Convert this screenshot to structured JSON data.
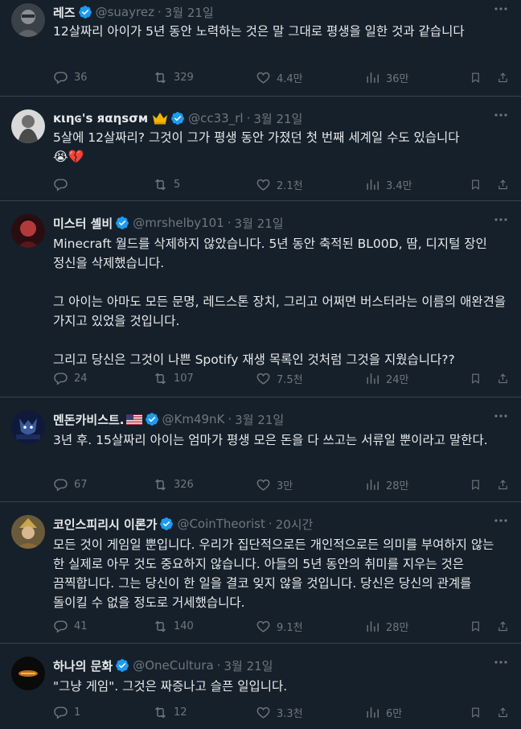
{
  "tweets": [
    {
      "name": "레즈",
      "handle": "@suayrez",
      "time": "3월 21일",
      "text": [
        "12살짜리 아이가 5년 동안 노력하는 것은 말 그대로 평생을 일한 것과 같습니다"
      ],
      "replies": "36",
      "retweets": "329",
      "likes": "4.4만",
      "views": "36만"
    },
    {
      "name": "ĸιηɢ's яαηѕσм",
      "handle": "@cc33_rl",
      "time": "3월 21일",
      "text": [
        "5살에 12살짜리? 그것이 그가 평생 동안 가졌던 첫 번째 세계일 수도 있습니다"
      ],
      "emoji": "😭💔",
      "replies": "",
      "retweets": "5",
      "likes": "2.1천",
      "views": "3.4만"
    },
    {
      "name": "미스터 셸비",
      "handle": "@mrshelby101",
      "time": "3월 21일",
      "text": [
        "Minecraft 월드를 삭제하지 않았습니다. 5년 동안 축적된 BL00D, 땀, 디지털 장인 정신을 삭제했습니다.",
        "그 아이는 아마도 모든 문명, 레드스톤 장치, 그리고 어쩌면 버스터라는 이름의 애완견을 가지고 있었을 것입니다.",
        "그리고 당신은 그것이 나쁜 Spotify 재생 목록인 것처럼 그것을 지웠습니다??"
      ],
      "replies": "24",
      "retweets": "107",
      "likes": "7.5천",
      "views": "24만"
    },
    {
      "name": "멘돈카비스트.",
      "handle": "@Km49nK",
      "time": "3월 21일",
      "text": [
        "3년 후. 15살짜리 아이는 엄마가 평생 모은 돈을 다 쓰고는 서류일 뿐이라고 말한다."
      ],
      "replies": "67",
      "retweets": "326",
      "likes": "3만",
      "views": "28만"
    },
    {
      "name": "코인스피리시 이론가",
      "handle": "@CoinTheorist",
      "time": "20시간",
      "text": [
        "모든 것이 게임일 뿐입니다. 우리가 집단적으로든 개인적으로든 의미를 부여하지 않는 한 실제로 아무 것도 중요하지 않습니다. 아들의 5년 동안의 취미를 지우는 것은 끔찍합니다. 그는 당신이 한 일을 결코 잊지 않을 것입니다. 당신은 당신의 관계를 돌이킬 수 없을 정도로 거세했습니다."
      ],
      "replies": "41",
      "retweets": "140",
      "likes": "9.1천",
      "views": "28만"
    },
    {
      "name": "하나의 문화",
      "handle": "@OneCultura",
      "time": "3월 21일",
      "text": [
        "\"그냥 게임\". 그것은 짜증나고 슬픈 일입니다."
      ],
      "replies": "1",
      "retweets": "12",
      "likes": "3.3천",
      "views": "6만"
    }
  ],
  "icons": [
    "reply-icon",
    "retweet-icon",
    "like-icon",
    "views-icon",
    "bookmark-icon",
    "share-icon",
    "more-icon",
    "verified-icon",
    "crown-icon"
  ],
  "colors": {
    "background": "#15202b",
    "text": "#e7e9ea",
    "muted": "#71767b",
    "verified": "#1d9bf0",
    "divider": "#38444d"
  }
}
